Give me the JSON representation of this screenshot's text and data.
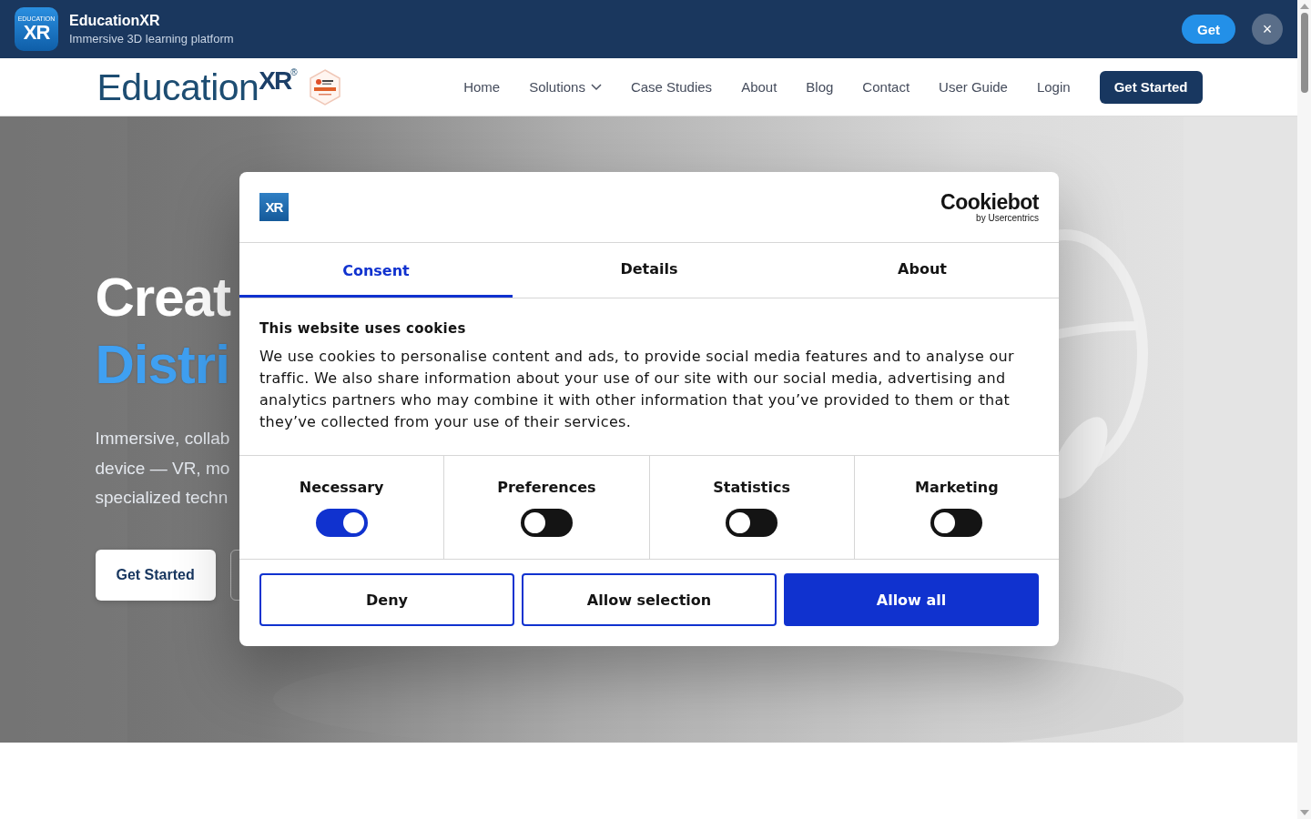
{
  "app_banner": {
    "icon_caption": "EDUCATION",
    "icon_mark": "XR",
    "title": "EducationXR",
    "subtitle": "Immersive 3D learning platform",
    "get_button": "Get",
    "close_button": "×"
  },
  "header": {
    "logo_text": "Education",
    "logo_accent": "XR",
    "logo_reg": "®",
    "nav": [
      {
        "label": "Home",
        "kind": "link"
      },
      {
        "label": "Solutions",
        "kind": "dropdown"
      },
      {
        "label": "Case Studies",
        "kind": "link"
      },
      {
        "label": "About",
        "kind": "link"
      },
      {
        "label": "Blog",
        "kind": "link"
      },
      {
        "label": "Contact",
        "kind": "link"
      },
      {
        "label": "User Guide",
        "kind": "link"
      },
      {
        "label": "Login",
        "kind": "link"
      }
    ],
    "cta": "Get Started"
  },
  "hero": {
    "line_1": "Creat",
    "line_2": "Distri",
    "paragraph_lines": [
      "Immersive, collab",
      "device — VR, mo",
      "specialized techn"
    ],
    "button": "Get Started"
  },
  "cookie_dialog": {
    "logo_mark": "XR",
    "brand": "Cookiebot",
    "brand_sub": "by Usercentrics",
    "tabs": [
      {
        "label": "Consent",
        "selected": true
      },
      {
        "label": "Details",
        "selected": false
      },
      {
        "label": "About",
        "selected": false
      }
    ],
    "heading": "This website uses cookies",
    "body": "We use cookies to personalise content and ads, to provide social media features and to analyse our traffic. We also share information about your use of our site with our social media, advertising and analytics partners who may combine it with other information that you’ve provided to them or that they’ve collected from your use of their services.",
    "categories": [
      {
        "label": "Necessary",
        "on": true
      },
      {
        "label": "Preferences",
        "on": false
      },
      {
        "label": "Statistics",
        "on": false
      },
      {
        "label": "Marketing",
        "on": false
      }
    ],
    "buttons": [
      {
        "label": "Deny",
        "kind": "outline"
      },
      {
        "label": "Allow selection",
        "kind": "outline"
      },
      {
        "label": "Allow all",
        "kind": "primary"
      }
    ]
  }
}
